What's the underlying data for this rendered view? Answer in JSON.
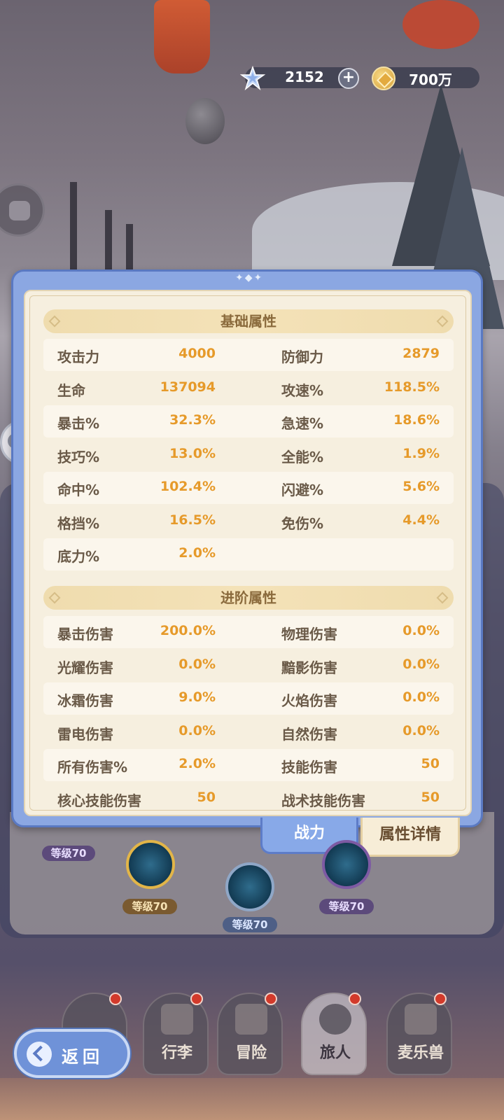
{
  "currency": {
    "gem_value": "2152",
    "coin_value": "700万",
    "colors": {
      "bar": "#373a4b",
      "coin": "#e3aa3f"
    }
  },
  "attributes_panel": {
    "basic_title": "基础属性",
    "basic_rows": [
      {
        "l1": "攻击力",
        "v1": "4000",
        "l2": "防御力",
        "v2": "2879"
      },
      {
        "l1": "生命",
        "v1": "137094",
        "l2": "攻速%",
        "v2": "118.5%"
      },
      {
        "l1": "暴击%",
        "v1": "32.3%",
        "l2": "急速%",
        "v2": "18.6%"
      },
      {
        "l1": "技巧%",
        "v1": "13.0%",
        "l2": "全能%",
        "v2": "1.9%"
      },
      {
        "l1": "命中%",
        "v1": "102.4%",
        "l2": "闪避%",
        "v2": "5.6%"
      },
      {
        "l1": "格挡%",
        "v1": "16.5%",
        "l2": "免伤%",
        "v2": "4.4%"
      },
      {
        "l1": "底力%",
        "v1": "2.0%",
        "l2": "",
        "v2": ""
      }
    ],
    "advanced_title": "进阶属性",
    "advanced_rows": [
      {
        "l1": "暴击伤害",
        "v1": "200.0%",
        "l2": "物理伤害",
        "v2": "0.0%"
      },
      {
        "l1": "光耀伤害",
        "v1": "0.0%",
        "l2": "黯影伤害",
        "v2": "0.0%"
      },
      {
        "l1": "冰霜伤害",
        "v1": "9.0%",
        "l2": "火焰伤害",
        "v2": "0.0%"
      },
      {
        "l1": "雷电伤害",
        "v1": "0.0%",
        "l2": "自然伤害",
        "v2": "0.0%"
      },
      {
        "l1": "所有伤害%",
        "v1": "2.0%",
        "l2": "技能伤害",
        "v2": "50"
      },
      {
        "l1": "核心技能伤害",
        "v1": "50",
        "l2": "战术技能伤害",
        "v2": "50"
      }
    ],
    "colors": {
      "label": "#6a5a48",
      "value": "#e69a2a",
      "frame": "#8ba7e2",
      "inner": "#f6efdf"
    }
  },
  "tabs": {
    "power": "战力",
    "detail": "属性详情"
  },
  "skills": {
    "level_badges": [
      "等级70",
      "等级70",
      "等级70",
      "等级70"
    ]
  },
  "bottom_nav": {
    "items": [
      {
        "label": "行李",
        "icon": "bag-icon",
        "has_dot": true
      },
      {
        "label": "冒险",
        "icon": "swords-icon",
        "has_dot": true
      },
      {
        "label": "旅人",
        "icon": "traveler-icon",
        "has_dot": true
      },
      {
        "label": "麦乐兽",
        "icon": "pet-icon",
        "has_dot": true
      }
    ],
    "back_label": "返回"
  }
}
